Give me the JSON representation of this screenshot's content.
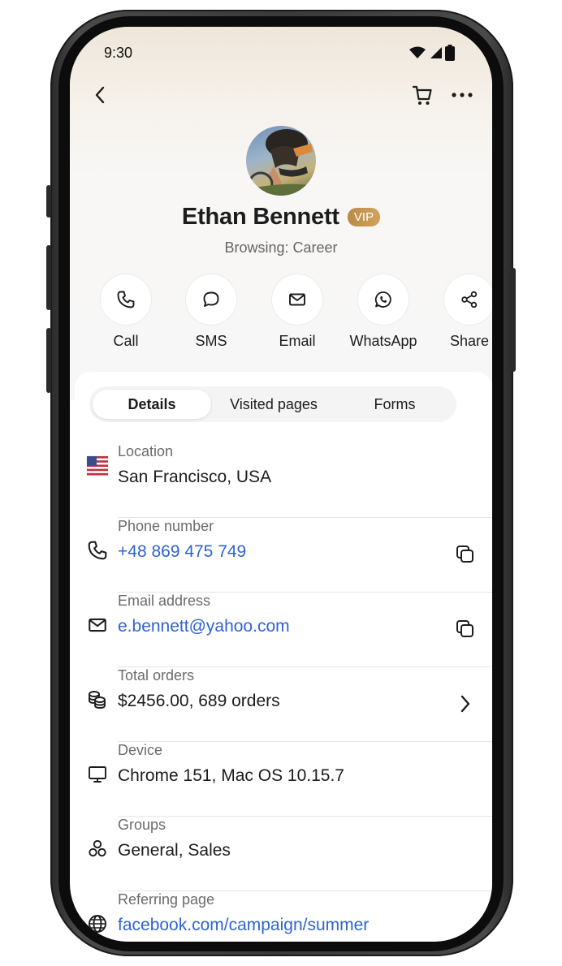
{
  "status": {
    "time": "9:30"
  },
  "profile": {
    "name": "Ethan Bennett",
    "badge": "VIP",
    "subtitle": "Browsing: Career"
  },
  "actions": [
    {
      "label": "Call",
      "icon": "phone-icon"
    },
    {
      "label": "SMS",
      "icon": "chat-bubble-icon"
    },
    {
      "label": "Email",
      "icon": "envelope-icon"
    },
    {
      "label": "WhatsApp",
      "icon": "whatsapp-icon"
    },
    {
      "label": "Share",
      "icon": "share-icon"
    }
  ],
  "tabs": [
    {
      "label": "Details",
      "active": true
    },
    {
      "label": "Visited pages",
      "active": false
    },
    {
      "label": "Forms",
      "active": false
    }
  ],
  "details": {
    "location": {
      "label": "Location",
      "value": "San Francisco, USA",
      "icon": "us-flag-icon"
    },
    "phone": {
      "label": "Phone number",
      "value": "+48 869 475 749",
      "icon": "phone-icon"
    },
    "email": {
      "label": "Email address",
      "value": "e.bennett@yahoo.com",
      "icon": "envelope-icon"
    },
    "orders": {
      "label": "Total orders",
      "value": "$2456.00, 689 orders",
      "icon": "coins-icon"
    },
    "device": {
      "label": "Device",
      "value": "Chrome 151, Mac OS 10.15.7",
      "icon": "monitor-icon"
    },
    "groups": {
      "label": "Groups",
      "value": "General, Sales",
      "icon": "groups-icon"
    },
    "referrer": {
      "label": "Referring page",
      "value": "facebook.com/campaign/summer",
      "icon": "globe-icon"
    }
  },
  "colors": {
    "link": "#2f63d4",
    "vip_badge": "#c49651"
  }
}
